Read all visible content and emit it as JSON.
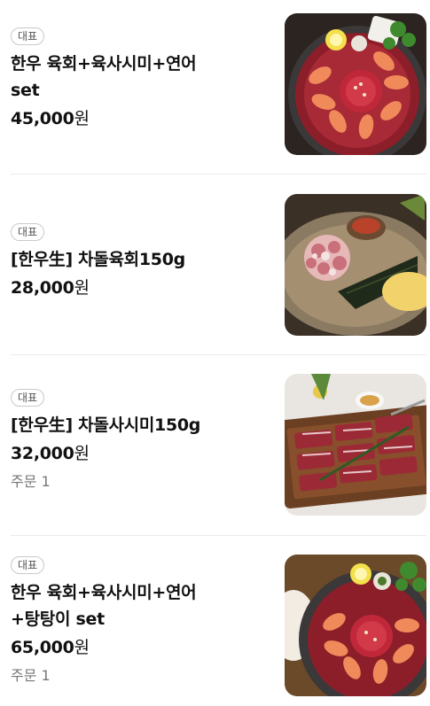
{
  "items": [
    {
      "badge": "대표",
      "name_line1": "한우 육회+육사시미+연어",
      "name_line2": "set",
      "price": "45,000",
      "currency": "원",
      "orders_label": "",
      "orders_count": ""
    },
    {
      "badge": "대표",
      "name_line1": "[한우生] 차돌육회150g",
      "name_line2": "",
      "price": "28,000",
      "currency": "원",
      "orders_label": "",
      "orders_count": ""
    },
    {
      "badge": "대표",
      "name_line1": "[한우生] 차돌사시미150g",
      "name_line2": "",
      "price": "32,000",
      "currency": "원",
      "orders_label": "주문",
      "orders_count": "1"
    },
    {
      "badge": "대표",
      "name_line1": "한우 육회+육사시미+연어",
      "name_line2": "+탕탕이 set",
      "price": "65,000",
      "currency": "원",
      "orders_label": "주문",
      "orders_count": "1"
    }
  ]
}
